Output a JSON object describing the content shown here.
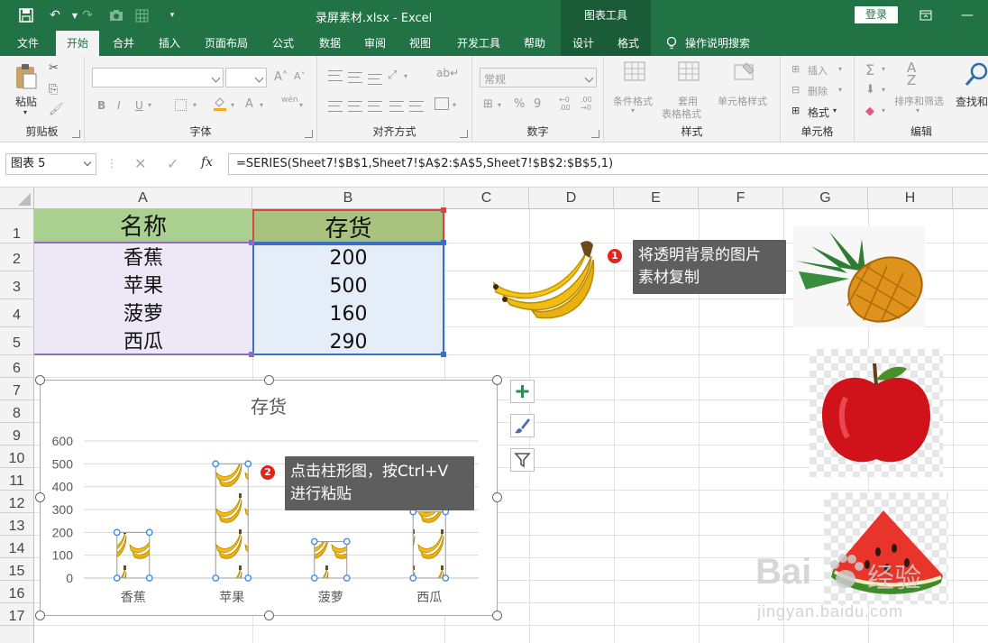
{
  "app": {
    "doc_title": "录屏素材.xlsx  -  Excel",
    "context_tab_group": "图表工具",
    "login_label": "登录"
  },
  "tabs": [
    {
      "label": "文件"
    },
    {
      "label": "开始"
    },
    {
      "label": "合并"
    },
    {
      "label": "插入"
    },
    {
      "label": "页面布局"
    },
    {
      "label": "公式"
    },
    {
      "label": "数据"
    },
    {
      "label": "审阅"
    },
    {
      "label": "视图"
    },
    {
      "label": "开发工具"
    },
    {
      "label": "帮助"
    },
    {
      "label": "设计"
    },
    {
      "label": "格式"
    }
  ],
  "tell_me": "操作说明搜索",
  "ribbon": {
    "clipboard": {
      "label": "剪贴板",
      "paste": "粘贴"
    },
    "font": {
      "label": "字体"
    },
    "alignment": {
      "label": "对齐方式"
    },
    "number": {
      "label": "数字",
      "format": "常规"
    },
    "styles": {
      "label": "样式",
      "conditional": "条件格式",
      "table_format_1": "套用",
      "table_format_2": "表格格式",
      "cell_styles": "单元格样式"
    },
    "cells": {
      "label": "单元格",
      "insert": "插入",
      "delete": "删除",
      "format": "格式"
    },
    "editing": {
      "label": "编辑",
      "sort_filter": "排序和筛选",
      "find": "查找和"
    }
  },
  "formula_bar": {
    "name_box": "图表 5",
    "fx": "fx",
    "formula": "=SERIES(Sheet7!$B$1,Sheet7!$A$2:$A$5,Sheet7!$B$2:$B$5,1)"
  },
  "sheet": {
    "columns": [
      "A",
      "B",
      "C",
      "D",
      "E",
      "F",
      "G",
      "H"
    ],
    "rows": [
      "1",
      "2",
      "3",
      "4",
      "5",
      "6",
      "7",
      "8",
      "9",
      "10",
      "11",
      "12",
      "13",
      "14",
      "15",
      "16",
      "17"
    ],
    "header": {
      "name": "名称",
      "stock": "存货"
    },
    "data": [
      {
        "name": "香蕉",
        "stock": "200"
      },
      {
        "name": "苹果",
        "stock": "500"
      },
      {
        "name": "菠萝",
        "stock": "160"
      },
      {
        "name": "西瓜",
        "stock": "290"
      }
    ]
  },
  "callouts": [
    {
      "badge": "1",
      "line1": "将透明背景的图片",
      "line2": "素材复制"
    },
    {
      "badge": "2",
      "line1": "点击柱形图，按Ctrl+V",
      "line2": "进行粘贴"
    }
  ],
  "watermark": {
    "brand": "Bai",
    "brand2": "经验",
    "url": "jingyan.baidu.com"
  },
  "colors": {
    "excel_green": "#217346",
    "header_a_fill": "#a9d08e",
    "header_b_fill": "#a9c27e",
    "data_a_fill": "#ede7f6",
    "data_b_fill": "#e4edf8",
    "badge_red": "#e1251b",
    "callout_bg": "#5e5e5e"
  },
  "chart_data": {
    "type": "bar",
    "title": "存货",
    "categories": [
      "香蕉",
      "苹果",
      "菠萝",
      "西瓜"
    ],
    "values": [
      200,
      500,
      160,
      290
    ],
    "ylim": [
      0,
      600
    ],
    "yticks": [
      "0",
      "100",
      "200",
      "300",
      "400",
      "500",
      "600"
    ],
    "grid": true,
    "legend": "none",
    "fill": "banana-picture"
  }
}
